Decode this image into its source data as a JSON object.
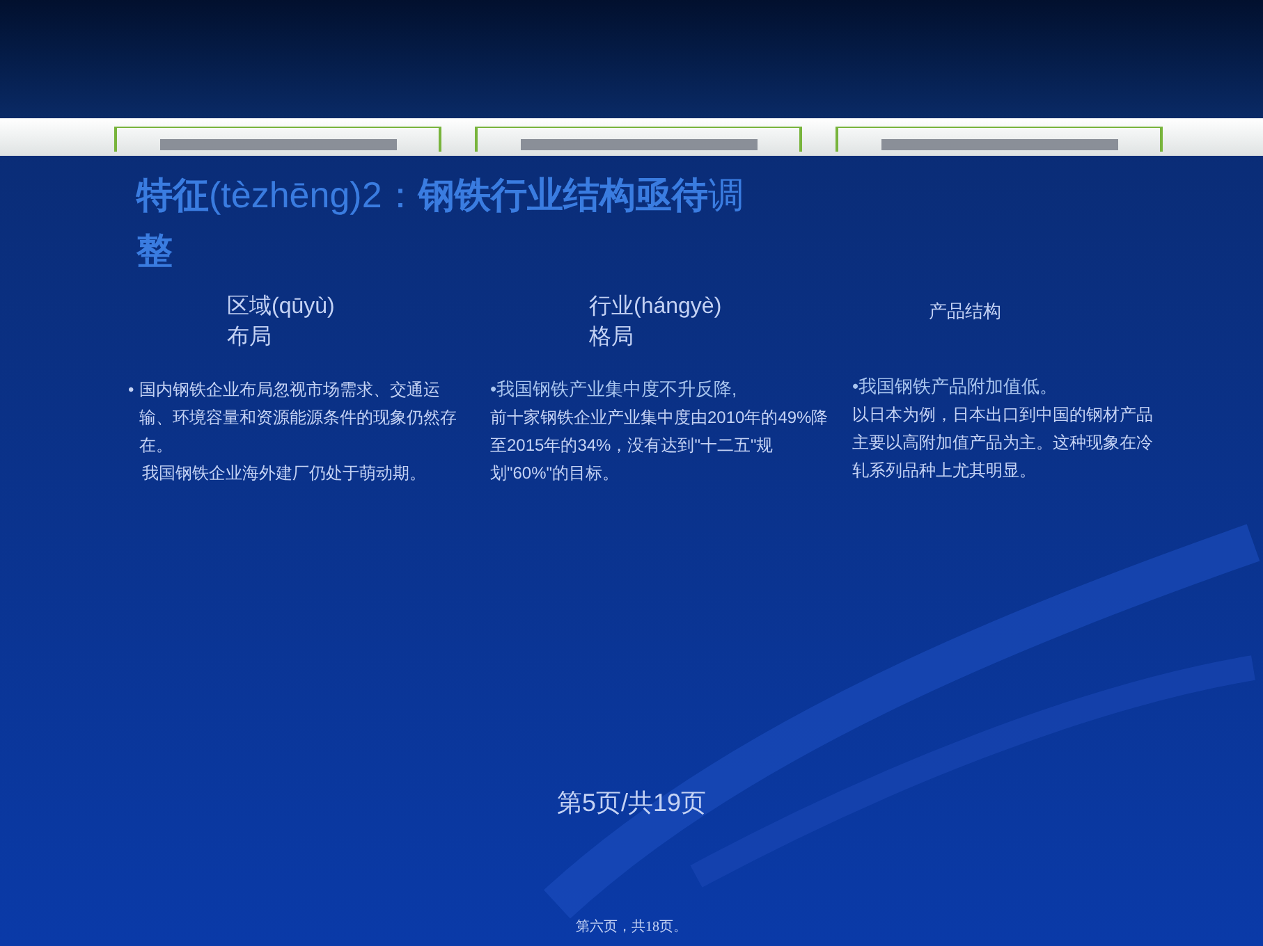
{
  "title": {
    "lines": [
      "**特征**(tèzhēng)2：**钢铁行业结构亟待**调",
      "**整**"
    ]
  },
  "columns": [
    {
      "heading": [
        "区域(qūyù)",
        "布局"
      ],
      "body": [
        "国内钢铁企业布局忽视市场需求、交通运输、环境容量和资源能源条件的现象仍然存在。",
        "我国钢铁企业海外建厂仍处于萌动期。"
      ],
      "bullet": "•"
    },
    {
      "heading": [
        "行业(hángyè)",
        "格局"
      ],
      "lead": "•我国钢铁产业集中度不升反降,",
      "body": [
        "前十家钢铁企业产业集中度由2010年的49%降至2015年的34%，没有达到\"十二五\"规划\"60%\"的目标。"
      ]
    },
    {
      "heading": [
        "产品结构"
      ],
      "lead": "•我国钢铁产品附加值低。",
      "body": [
        "以日本为例，日本出口到中国的钢材产品主要以高附加值产品为主。这种现象在冷轧系列品种上尤其明显。"
      ]
    }
  ],
  "page_number": "第5页/共19页",
  "footer": "第六页，共18页。"
}
